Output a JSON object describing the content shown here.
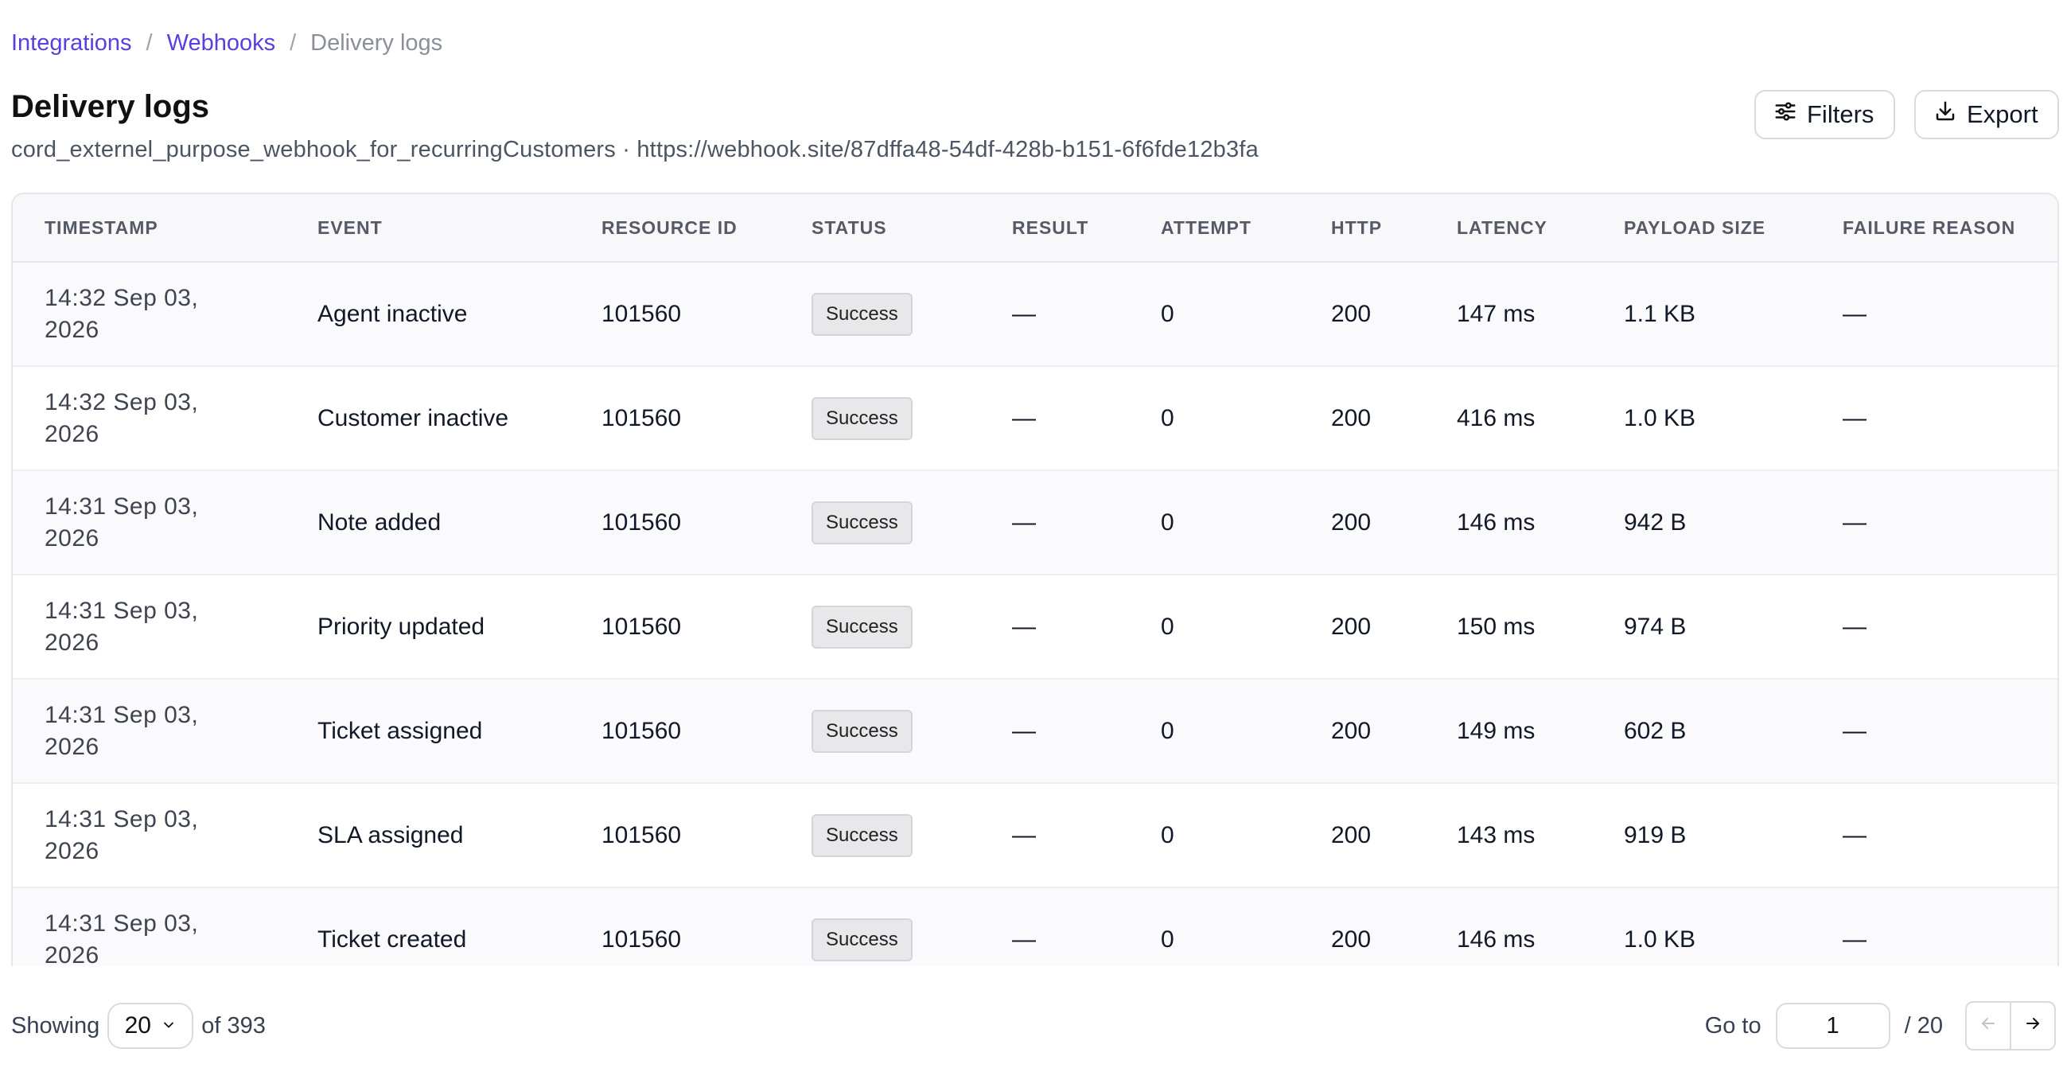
{
  "breadcrumb": {
    "items": [
      "Integrations",
      "Webhooks"
    ],
    "separator": "/",
    "current": "Delivery logs"
  },
  "page": {
    "title": "Delivery logs",
    "subtitle": "cord_externel_purpose_webhook_for_recurringCustomers · https://webhook.site/87dffa48-54df-428b-b151-6f6fde12b3fa"
  },
  "toolbar": {
    "filters_label": "Filters",
    "export_label": "Export",
    "filters_icon": "sliders-icon",
    "export_icon": "download-icon"
  },
  "table": {
    "columns": [
      "TIMESTAMP",
      "EVENT",
      "RESOURCE ID",
      "STATUS",
      "RESULT",
      "ATTEMPT",
      "HTTP",
      "LATENCY",
      "PAYLOAD SIZE",
      "FAILURE REASON"
    ],
    "rows": [
      {
        "time": "14:32 Sep 03,",
        "year": "2026",
        "event": "Agent inactive",
        "resource_id": "101560",
        "status": "Success",
        "result": "—",
        "attempt": "0",
        "http": "200",
        "latency": "147 ms",
        "payload": "1.1 KB",
        "failure": "—"
      },
      {
        "time": "14:32 Sep 03,",
        "year": "2026",
        "event": "Customer inactive",
        "resource_id": "101560",
        "status": "Success",
        "result": "—",
        "attempt": "0",
        "http": "200",
        "latency": "416 ms",
        "payload": "1.0 KB",
        "failure": "—"
      },
      {
        "time": "14:31 Sep 03,",
        "year": "2026",
        "event": "Note added",
        "resource_id": "101560",
        "status": "Success",
        "result": "—",
        "attempt": "0",
        "http": "200",
        "latency": "146 ms",
        "payload": "942 B",
        "failure": "—"
      },
      {
        "time": "14:31 Sep 03,",
        "year": "2026",
        "event": "Priority updated",
        "resource_id": "101560",
        "status": "Success",
        "result": "—",
        "attempt": "0",
        "http": "200",
        "latency": "150 ms",
        "payload": "974 B",
        "failure": "—"
      },
      {
        "time": "14:31 Sep 03,",
        "year": "2026",
        "event": "Ticket assigned",
        "resource_id": "101560",
        "status": "Success",
        "result": "—",
        "attempt": "0",
        "http": "200",
        "latency": "149 ms",
        "payload": "602 B",
        "failure": "—"
      },
      {
        "time": "14:31 Sep 03,",
        "year": "2026",
        "event": "SLA assigned",
        "resource_id": "101560",
        "status": "Success",
        "result": "—",
        "attempt": "0",
        "http": "200",
        "latency": "143 ms",
        "payload": "919 B",
        "failure": "—"
      },
      {
        "time": "14:31 Sep 03,",
        "year": "2026",
        "event": "Ticket created",
        "resource_id": "101560",
        "status": "Success",
        "result": "—",
        "attempt": "0",
        "http": "200",
        "latency": "146 ms",
        "payload": "1.0 KB",
        "failure": "—"
      }
    ]
  },
  "footer": {
    "showing_label": "Showing",
    "page_size": "20",
    "of_label": "of 393",
    "goto_label": "Go to",
    "current_page": "1",
    "total_pages_label": "/ 20"
  }
}
